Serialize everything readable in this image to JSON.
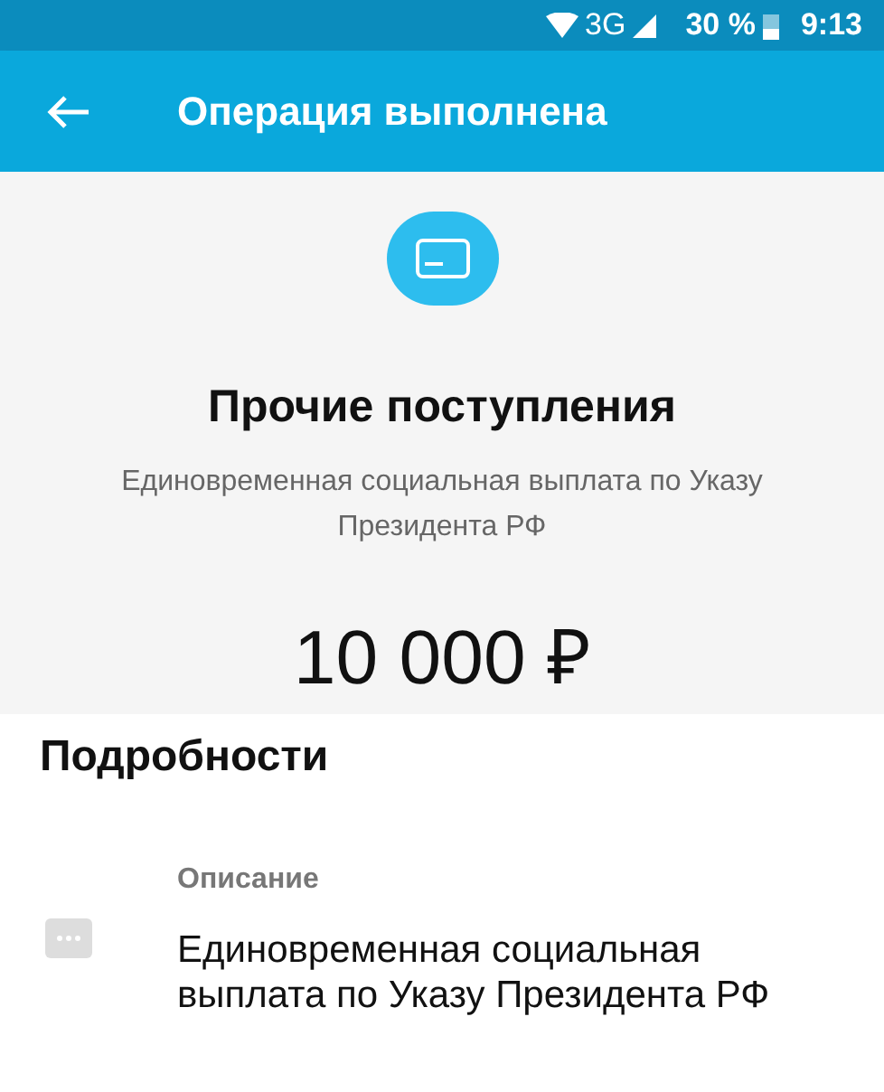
{
  "status_bar": {
    "network": "3G",
    "battery": "30 %",
    "time": "9:13"
  },
  "app_bar": {
    "title": "Операция выполнена"
  },
  "operation": {
    "title": "Прочие поступления",
    "subtitle": "Единовременная социальная выплата по Указу Президента РФ",
    "amount": "10 000 ₽"
  },
  "details": {
    "heading": "Подробности",
    "items": [
      {
        "label": "Описание",
        "value": "Единовременная социальная выплата по Указу Президента РФ"
      }
    ]
  }
}
